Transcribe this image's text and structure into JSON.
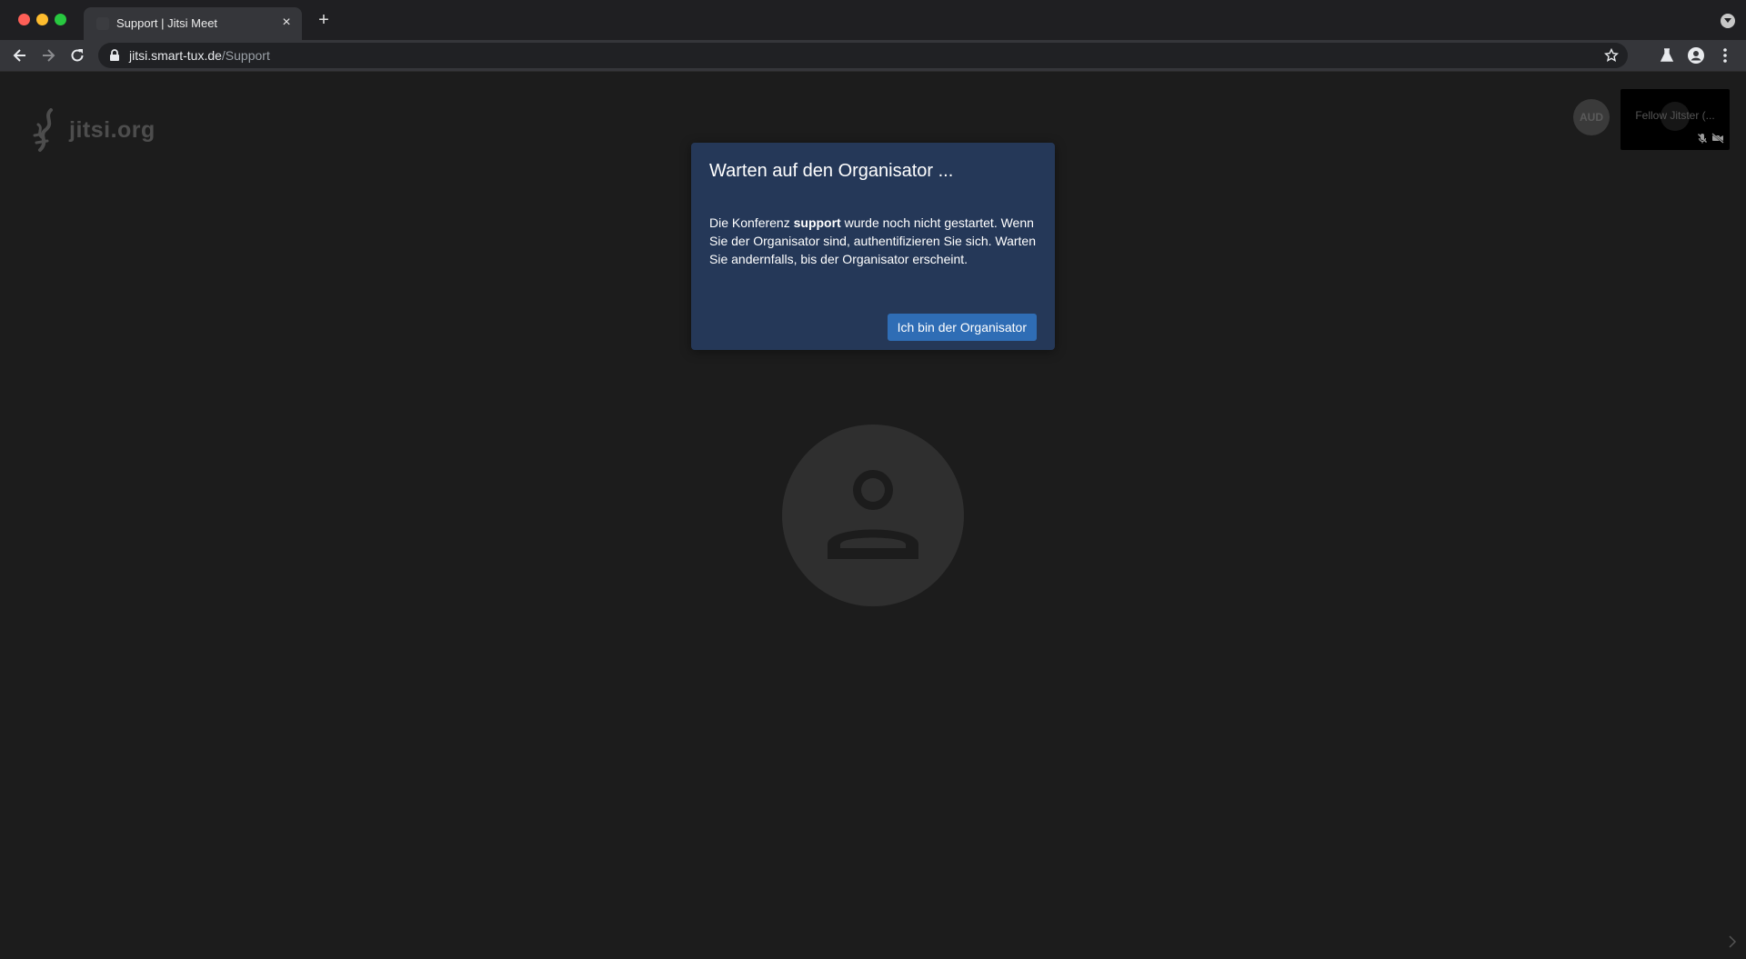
{
  "browser": {
    "tab": {
      "title": "Support | Jitsi Meet"
    },
    "new_tab_label": "+",
    "close_tab_label": "×",
    "url": {
      "host": "jitsi.smart-tux.de",
      "path": "/Support"
    }
  },
  "page": {
    "watermark": {
      "text": "jitsi.org"
    },
    "audio_badge": {
      "text": "AUD"
    },
    "filmstrip": {
      "name": "Fellow Jitster (..."
    }
  },
  "dialog": {
    "title": "Warten auf den Organisator ...",
    "body_prefix": "Die Konferenz ",
    "room_name": "support",
    "body_suffix": " wurde noch nicht gestartet. Wenn Sie der Organisator sind, authentifizieren Sie sich. Warten Sie andernfalls, bis der Organisator erscheint.",
    "button_label": "Ich bin der Organisator"
  },
  "colors": {
    "page_background": "#1c1c1c",
    "dialog_background": "#253858",
    "primary_button": "#2f6db5"
  }
}
